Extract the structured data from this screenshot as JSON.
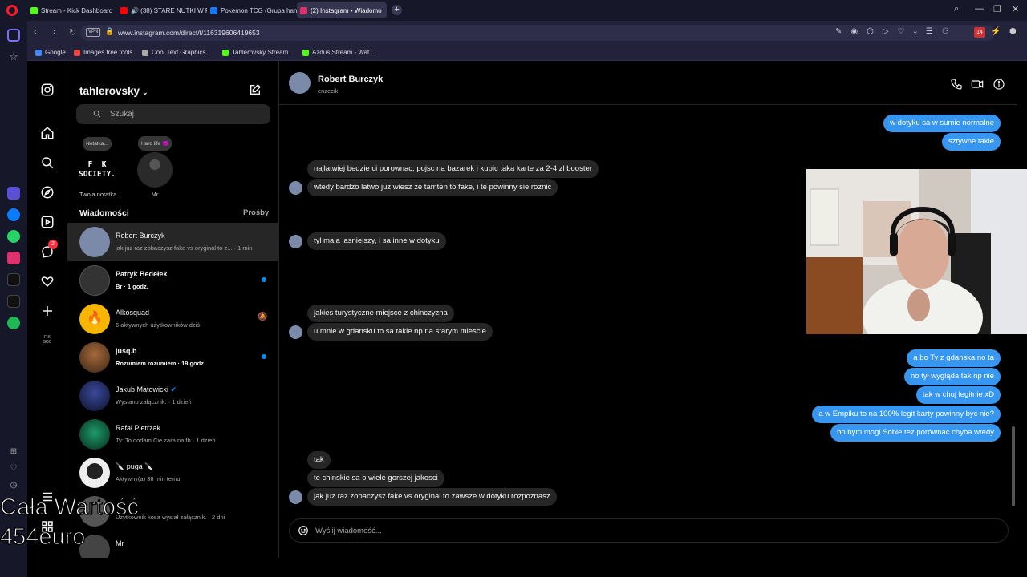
{
  "browser": {
    "tabs": [
      {
        "title": "Stream - Kick Dashboard",
        "color": "#53fc18"
      },
      {
        "title": "🔊 (38) STARE NUTKI W F",
        "color": "#ff0000"
      },
      {
        "title": "Pokemon TCG (Grupa han",
        "color": "#1877f2"
      },
      {
        "title": "(2) Instagram • Wiadomo",
        "color": "#e1306c"
      }
    ],
    "url": "www.instagram.com/direct/t/116319606419653",
    "vpn": "VPN",
    "badge": "14",
    "bookmarks": [
      {
        "label": "Google",
        "color": "#4285f4"
      },
      {
        "label": "Images free tools",
        "color": "#e44"
      },
      {
        "label": "Cool Text Graphics...",
        "color": "#aaa"
      },
      {
        "label": "Tahlerovsky Stream...",
        "color": "#53fc18"
      },
      {
        "label": "Azdus Stream - Wat...",
        "color": "#53fc18"
      }
    ],
    "sidebar_badge": "2"
  },
  "ig": {
    "username": "tahlerovsky",
    "search_placeholder": "Szukaj",
    "notes": [
      {
        "bubble": "Notatka...",
        "label": "Twoja notatka",
        "avatar_text": "F  K\nSOCIETY."
      },
      {
        "bubble": "Hard life 😈",
        "label": "Mr"
      }
    ],
    "messages_heading": "Wiadomości",
    "requests_heading": "Prośby",
    "conversations": [
      {
        "name": "Robert Burczyk",
        "preview": "jak juz raz zobaczysz fake vs oryginal to z... · 1 min",
        "active": true,
        "bold": false,
        "unread": false,
        "muted": false,
        "color": "#7a8aa8"
      },
      {
        "name": "Patryk Bedełek",
        "preview": "Br · 1 godz.",
        "active": false,
        "bold": true,
        "unread": true,
        "muted": false,
        "color": "#333"
      },
      {
        "name": "Alkosquad",
        "preview": "6 aktywnych użytkowników dziś",
        "active": false,
        "bold": false,
        "unread": false,
        "muted": true,
        "color": "#f7b500"
      },
      {
        "name": "jusq.b",
        "preview": "Rozumiem rozumiem · 19 godz.",
        "active": false,
        "bold": true,
        "unread": true,
        "muted": false,
        "color": "#6a3f23"
      },
      {
        "name": "Jakub Matowicki",
        "preview": "Wysłano załącznik. · 1 dzień",
        "active": false,
        "bold": false,
        "unread": false,
        "muted": false,
        "color": "#1e2a5a",
        "verified": true
      },
      {
        "name": "Rafał Pietrzak",
        "preview": "Ty: To dodam Cie zara na fb · 1 dzień",
        "active": false,
        "bold": false,
        "unread": false,
        "muted": false,
        "color": "#0f5a3a"
      },
      {
        "name": "🔪 puga 🔪",
        "preview": "Aktywny(a) 36 min temu",
        "active": false,
        "bold": false,
        "unread": false,
        "muted": false,
        "color": "#e8e8e8"
      },
      {
        "name": "",
        "preview": "Użytkownik kosa wysłał załącznik. · 2 dni",
        "active": false,
        "bold": false,
        "unread": false,
        "muted": false,
        "color": "#555"
      },
      {
        "name": "Mr",
        "preview": "",
        "active": false,
        "bold": false,
        "unread": false,
        "muted": false,
        "color": "#444"
      }
    ]
  },
  "chat": {
    "name": "Robert Burczyk",
    "handle": "enzecik",
    "composer_placeholder": "Wyślij wiadomość...",
    "messages": [
      {
        "dir": "out",
        "text": "w dotyku sa w sumie normalne",
        "avatar": false
      },
      {
        "dir": "out",
        "text": "sztywne takie",
        "avatar": false
      },
      {
        "dir": "in",
        "text": "najlatwiej bedzie ci porownac, pojsc na bazarek i kupic taka karte za 2-4 zl booster",
        "avatar": false
      },
      {
        "dir": "in",
        "text": "wtedy bardzo latwo juz wiesz ze tamten to fake, i te powinny sie roznic",
        "avatar": true
      },
      {
        "dir": "in",
        "text": "tyl maja jasniejszy, i sa inne w dotyku",
        "avatar": true
      },
      {
        "dir": "in",
        "text": "jakies turystyczne miejsce z chinczyzna",
        "avatar": false
      },
      {
        "dir": "in",
        "text": "u mnie w gdansku to sa takie np na starym miescie",
        "avatar": true
      },
      {
        "dir": "out",
        "text": "a bo Ty z gdanska no ta",
        "avatar": false
      },
      {
        "dir": "out",
        "text": "no tył wygląda tak np nie",
        "avatar": false
      },
      {
        "dir": "out",
        "text": "tak w chuj legitnie xD",
        "avatar": false
      },
      {
        "dir": "out",
        "text": "a w Empiku to na 100% legit karty powinny byc nie?",
        "avatar": false
      },
      {
        "dir": "out",
        "text": "bo bym mogl Sobie tez porównac chyba wtedy",
        "avatar": false
      },
      {
        "dir": "in",
        "text": "tak",
        "avatar": false
      },
      {
        "dir": "in",
        "text": "te chinskie sa o wiele gorszej jakosci",
        "avatar": false
      },
      {
        "dir": "in",
        "text": "jak juz raz zobaczysz fake vs oryginal to zawsze w dotyku rozpoznasz",
        "avatar": true
      }
    ]
  },
  "overlay": {
    "line1": "Cała Wartość",
    "line2": "454euro"
  },
  "colors": {
    "accent": "#3797f0",
    "unread": "#0095f6",
    "incoming_bubble": "#262626"
  }
}
